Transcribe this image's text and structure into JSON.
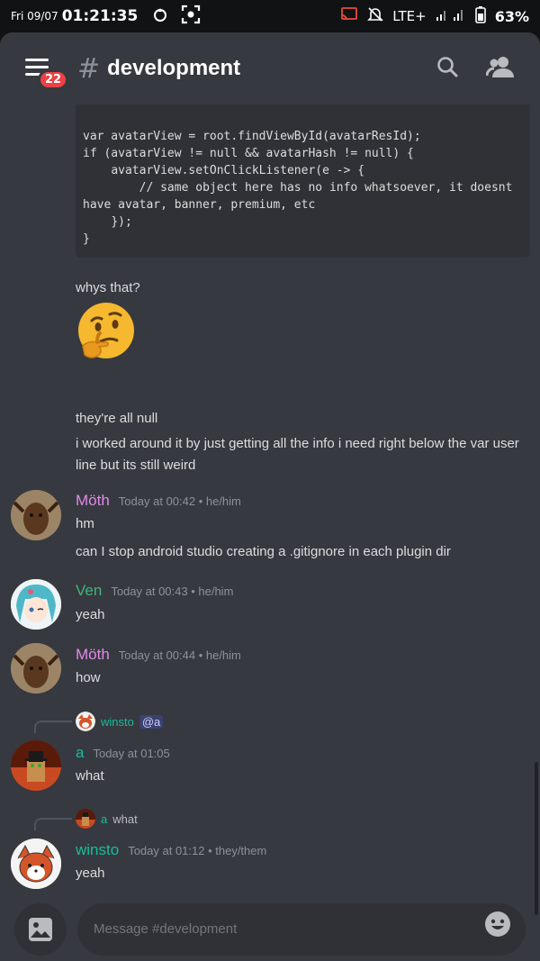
{
  "status_bar": {
    "date": "Fri 09/07",
    "time": "01:21:35",
    "network": "LTE+",
    "battery": "63%"
  },
  "header": {
    "badge_count": "22",
    "hash": "#",
    "channel": "development"
  },
  "code_block": {
    "text": "var avatarView = root.findViewById(avatarResId);\nif (avatarView != null && avatarHash != null) {\n    avatarView.setOnClickListener(e -> {\n        // same object here has no info whatsoever, it doesnt have avatar, banner, premium, etc\n    });\n}"
  },
  "messages": [
    {
      "text": "whys that?"
    },
    {
      "emoji": "thinking-face"
    },
    {
      "text": "they're all null"
    },
    {
      "text": "i worked around it by just getting all the info i need right below the var user line but its still weird"
    }
  ],
  "groups": [
    {
      "user": "Möth",
      "color": "#e08ae8",
      "meta": "Today at 00:42 • he/him",
      "lines": [
        "hm",
        "can I stop android studio creating a .gitignore in each plugin dir"
      ]
    },
    {
      "user": "Ven",
      "color": "#43b581",
      "meta": "Today at 00:43 • he/him",
      "lines": [
        "yeah"
      ]
    },
    {
      "user": "Möth",
      "color": "#e08ae8",
      "meta": "Today at 00:44 • he/him",
      "lines": [
        "how"
      ]
    },
    {
      "reply_user": "winsto",
      "reply_text": "@a",
      "user": "a",
      "color": "#1abc9c",
      "meta": "Today at 01:05",
      "lines": [
        "what"
      ]
    },
    {
      "reply_user": "a",
      "reply_text": "what",
      "user": "winsto",
      "color": "#1abc9c",
      "meta": "Today at 01:12 • they/them",
      "lines": [
        "yeah"
      ]
    }
  ],
  "input": {
    "placeholder": "Message #development"
  }
}
